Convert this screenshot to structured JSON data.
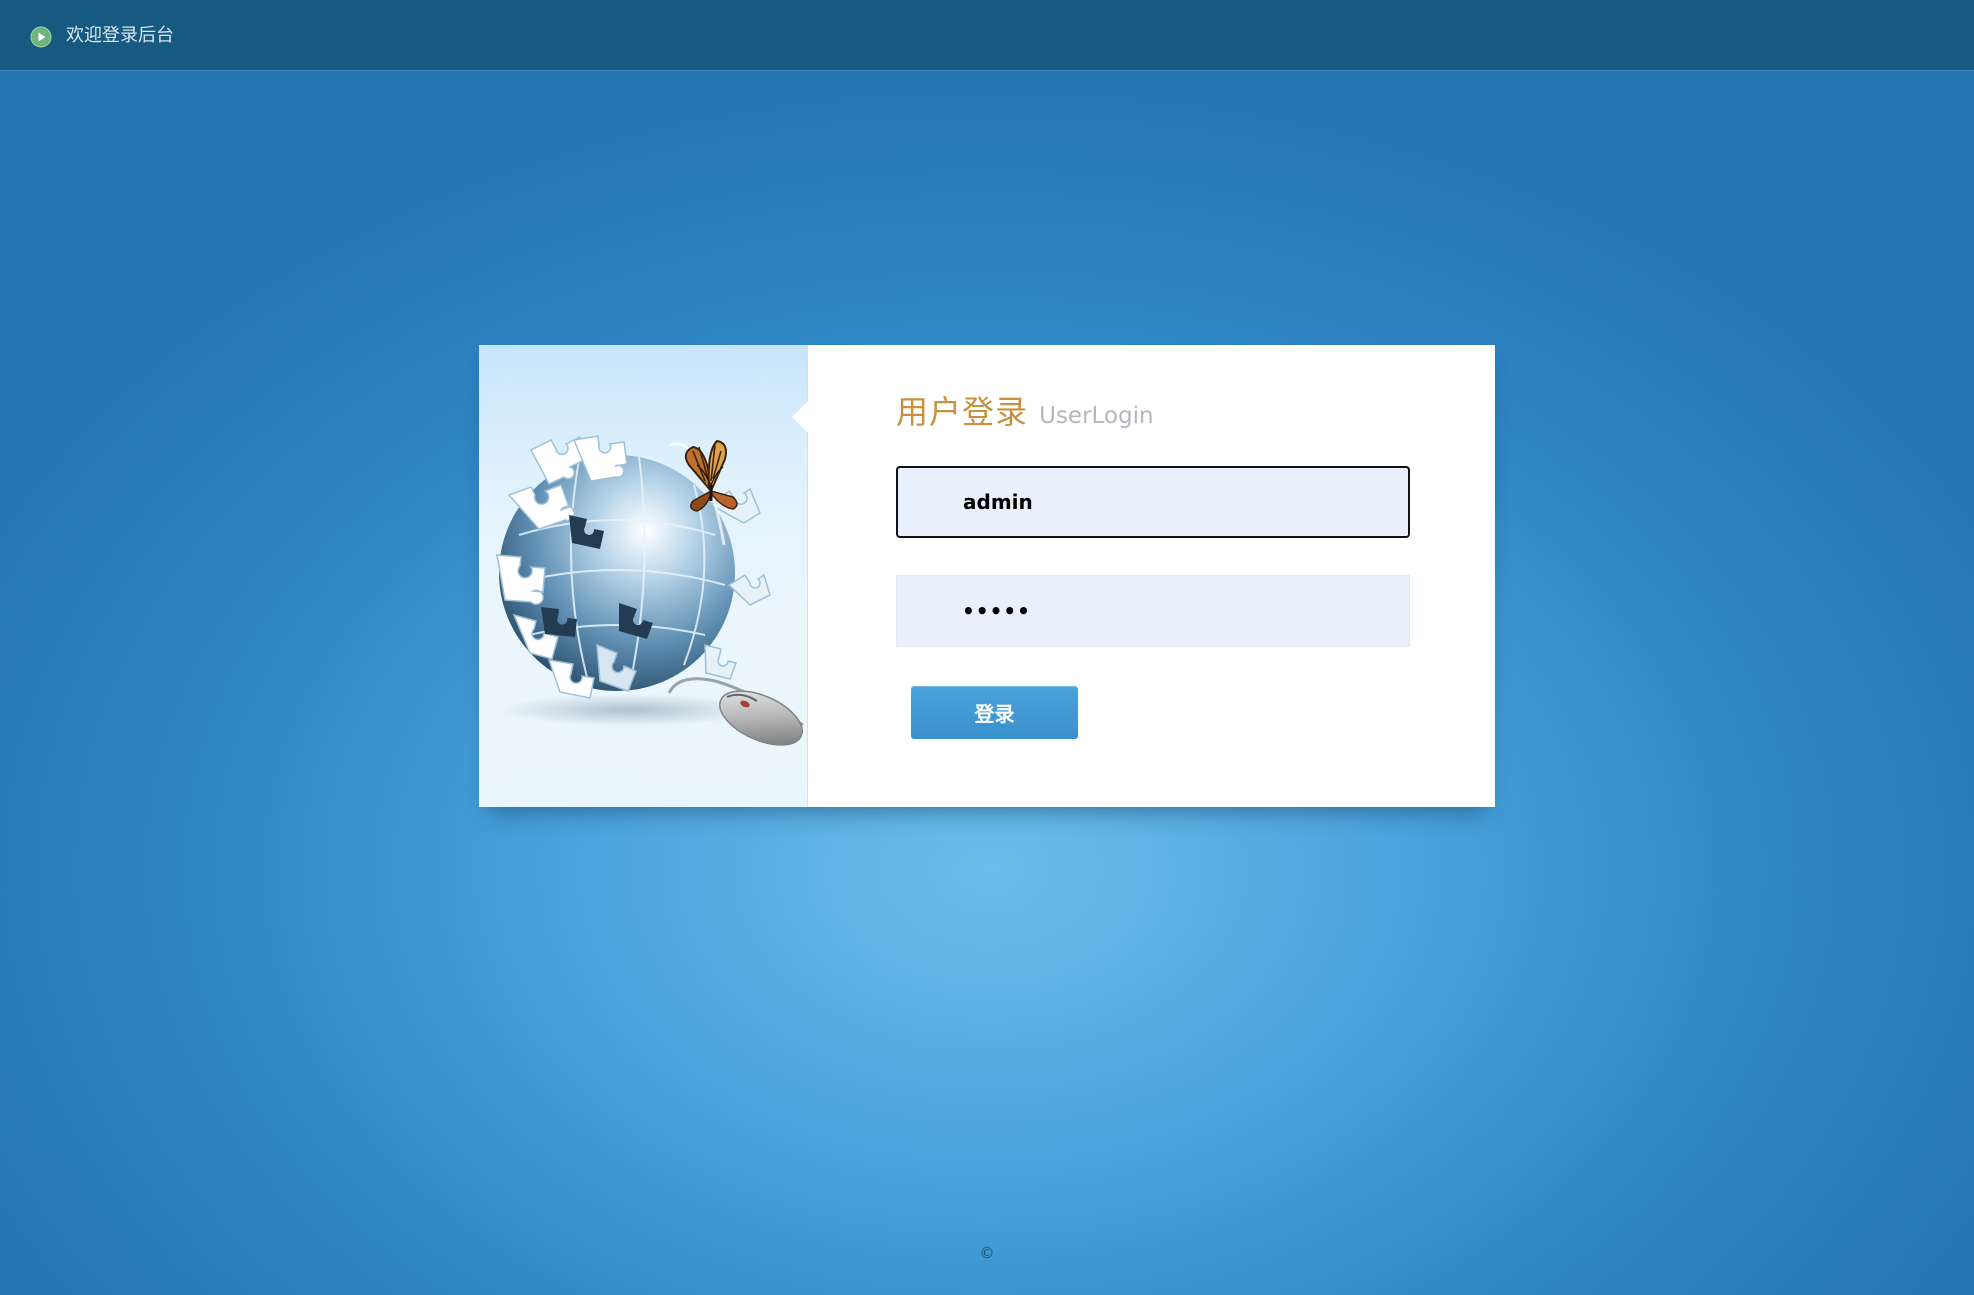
{
  "header": {
    "title": "欢迎登录后台",
    "icon": "play-circle-icon"
  },
  "illustration": {
    "icons": [
      "puzzle-globe-icon",
      "butterfly-icon",
      "computer-mouse-icon"
    ]
  },
  "login": {
    "title_cn": "用户登录",
    "title_en": "UserLogin",
    "username_value": "admin",
    "password_value": "12345",
    "submit_label": "登录"
  },
  "footer": {
    "copyright": "©"
  },
  "colors": {
    "header_bg": "#165a82",
    "page_bg_center": "#6cbdec",
    "page_bg_edge": "#2577b3",
    "title_gold": "#c8913f",
    "subtitle_gray": "#b3b8bd",
    "input_bg": "#e8f0fc",
    "button_blue": "#3f97d2"
  }
}
